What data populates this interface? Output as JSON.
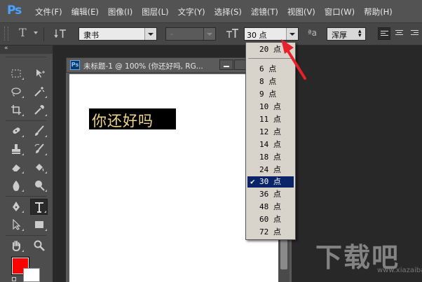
{
  "app": {
    "logo": "Ps"
  },
  "menu": [
    "文件(F)",
    "编辑(E)",
    "图像(I)",
    "图层(L)",
    "文字(Y)",
    "选择(S)",
    "滤镜(T)",
    "视图(V)",
    "窗口(W)",
    "帮助(H)"
  ],
  "options_bar": {
    "font_family": "隶书",
    "font_style": "-",
    "font_size": "30 点",
    "aa_label": "ªa",
    "antialias": "浑厚"
  },
  "document": {
    "title": "未标题-1 @ 100% (你还好吗, RG...",
    "text_content": "你还好吗"
  },
  "font_size_list": {
    "top_item": "20 点",
    "items": [
      "6 点",
      "8 点",
      "9 点",
      "10 点",
      "11 点",
      "12 点",
      "14 点",
      "18 点",
      "24 点",
      "30 点",
      "36 点",
      "48 点",
      "60 点",
      "72 点"
    ],
    "selected": "30 点",
    "check": "✔"
  },
  "colors": {
    "foreground": "#ff0000",
    "background": "#ffffff",
    "selection": "#0a246a",
    "annotation_arrow": "#e8202a"
  },
  "watermark": {
    "text": "下载吧",
    "url": "www.xiazaiba.com"
  }
}
